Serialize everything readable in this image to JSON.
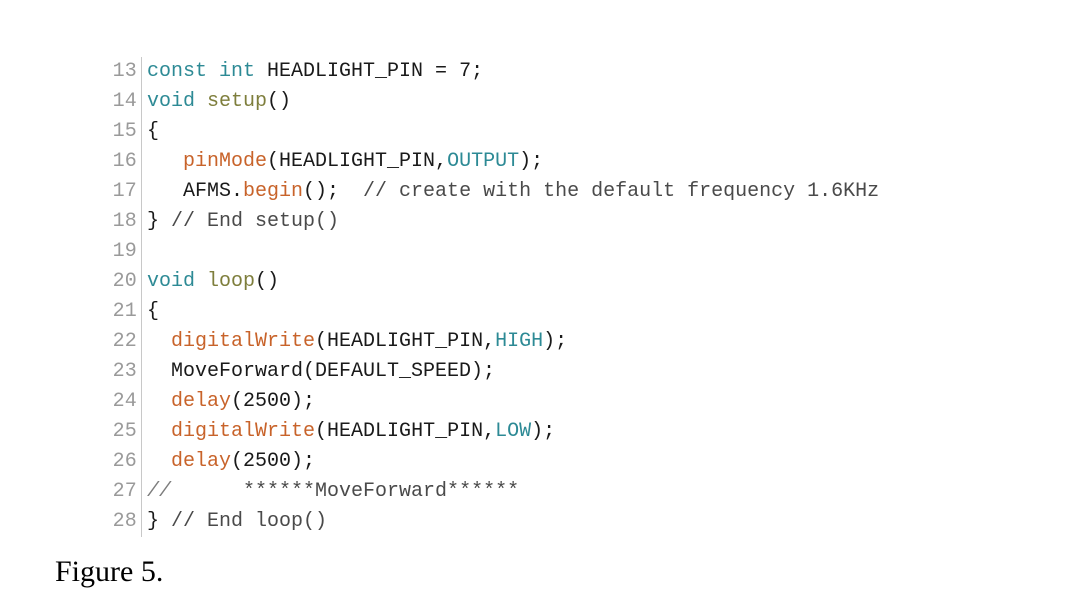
{
  "document": {
    "background_color": "#ffffff",
    "caption": "Figure 5."
  },
  "colors": {
    "keyword": "#2d8a95",
    "constant": "#2d8a95",
    "function_def": "#7e7e3c",
    "library_call": "#c8632a",
    "comment": "#7d7d7d",
    "plain": "#1a1a1a",
    "line_number": "#9a9a9a",
    "gutter_divider": "#c8c8c8"
  },
  "code_listing": {
    "language": "arduino-c++",
    "first_line_number": 13,
    "last_line_number": 28,
    "lines": [
      {
        "number": "13",
        "text": "const int HEADLIGHT_PIN = 7;",
        "tokens": [
          {
            "t": "const int ",
            "c": "tk-kw"
          },
          {
            "t": "HEADLIGHT_PIN = 7;",
            "c": "tk-plain"
          }
        ]
      },
      {
        "number": "14",
        "text": "void setup()",
        "tokens": [
          {
            "t": "void ",
            "c": "tk-kw"
          },
          {
            "t": "setup",
            "c": "tk-fn"
          },
          {
            "t": "()",
            "c": "tk-plain"
          }
        ]
      },
      {
        "number": "15",
        "text": "{",
        "tokens": [
          {
            "t": "{",
            "c": "tk-plain"
          }
        ]
      },
      {
        "number": "16",
        "text": "   pinMode(HEADLIGHT_PIN,OUTPUT);",
        "tokens": [
          {
            "t": "   ",
            "c": "tk-plain"
          },
          {
            "t": "pinMode",
            "c": "tk-lib"
          },
          {
            "t": "(HEADLIGHT_PIN,",
            "c": "tk-plain"
          },
          {
            "t": "OUTPUT",
            "c": "tk-const"
          },
          {
            "t": ");",
            "c": "tk-plain"
          }
        ]
      },
      {
        "number": "17",
        "text": "   AFMS.begin();  // create with the default frequency 1.6KHz",
        "tokens": [
          {
            "t": "   AFMS.",
            "c": "tk-plain"
          },
          {
            "t": "begin",
            "c": "tk-lib"
          },
          {
            "t": "();  ",
            "c": "tk-plain"
          },
          {
            "t": "// create with the default frequency 1.6KHz",
            "c": "tk-comment-plain"
          }
        ]
      },
      {
        "number": "18",
        "text": "} // End setup()",
        "tokens": [
          {
            "t": "} ",
            "c": "tk-plain"
          },
          {
            "t": "// End setup()",
            "c": "tk-comment-plain"
          }
        ]
      },
      {
        "number": "19",
        "text": "",
        "tokens": []
      },
      {
        "number": "20",
        "text": "void loop()",
        "tokens": [
          {
            "t": "void ",
            "c": "tk-kw"
          },
          {
            "t": "loop",
            "c": "tk-fn"
          },
          {
            "t": "()",
            "c": "tk-plain"
          }
        ]
      },
      {
        "number": "21",
        "text": "{",
        "tokens": [
          {
            "t": "{",
            "c": "tk-plain"
          }
        ]
      },
      {
        "number": "22",
        "text": "  digitalWrite(HEADLIGHT_PIN,HIGH);",
        "tokens": [
          {
            "t": "  ",
            "c": "tk-plain"
          },
          {
            "t": "digitalWrite",
            "c": "tk-lib"
          },
          {
            "t": "(HEADLIGHT_PIN,",
            "c": "tk-plain"
          },
          {
            "t": "HIGH",
            "c": "tk-const"
          },
          {
            "t": ");",
            "c": "tk-plain"
          }
        ]
      },
      {
        "number": "23",
        "text": "  MoveForward(DEFAULT_SPEED);",
        "tokens": [
          {
            "t": "  MoveForward(DEFAULT_SPEED);",
            "c": "tk-plain"
          }
        ]
      },
      {
        "number": "24",
        "text": "  delay(2500);",
        "tokens": [
          {
            "t": "  ",
            "c": "tk-plain"
          },
          {
            "t": "delay",
            "c": "tk-lib"
          },
          {
            "t": "(2500);",
            "c": "tk-plain"
          }
        ]
      },
      {
        "number": "25",
        "text": "  digitalWrite(HEADLIGHT_PIN,LOW);",
        "tokens": [
          {
            "t": "  ",
            "c": "tk-plain"
          },
          {
            "t": "digitalWrite",
            "c": "tk-lib"
          },
          {
            "t": "(HEADLIGHT_PIN,",
            "c": "tk-plain"
          },
          {
            "t": "LOW",
            "c": "tk-const"
          },
          {
            "t": ");",
            "c": "tk-plain"
          }
        ]
      },
      {
        "number": "26",
        "text": "  delay(2500);",
        "tokens": [
          {
            "t": "  ",
            "c": "tk-plain"
          },
          {
            "t": "delay",
            "c": "tk-lib"
          },
          {
            "t": "(2500);",
            "c": "tk-plain"
          }
        ]
      },
      {
        "number": "27",
        "text": "//      ******MoveForward******",
        "tokens": [
          {
            "t": "//",
            "c": "tk-comment"
          },
          {
            "t": "      ******MoveForward******",
            "c": "tk-comment-plain"
          }
        ]
      },
      {
        "number": "28",
        "text": "} // End loop()",
        "tokens": [
          {
            "t": "} ",
            "c": "tk-plain"
          },
          {
            "t": "// End loop()",
            "c": "tk-comment-plain"
          }
        ]
      }
    ]
  }
}
